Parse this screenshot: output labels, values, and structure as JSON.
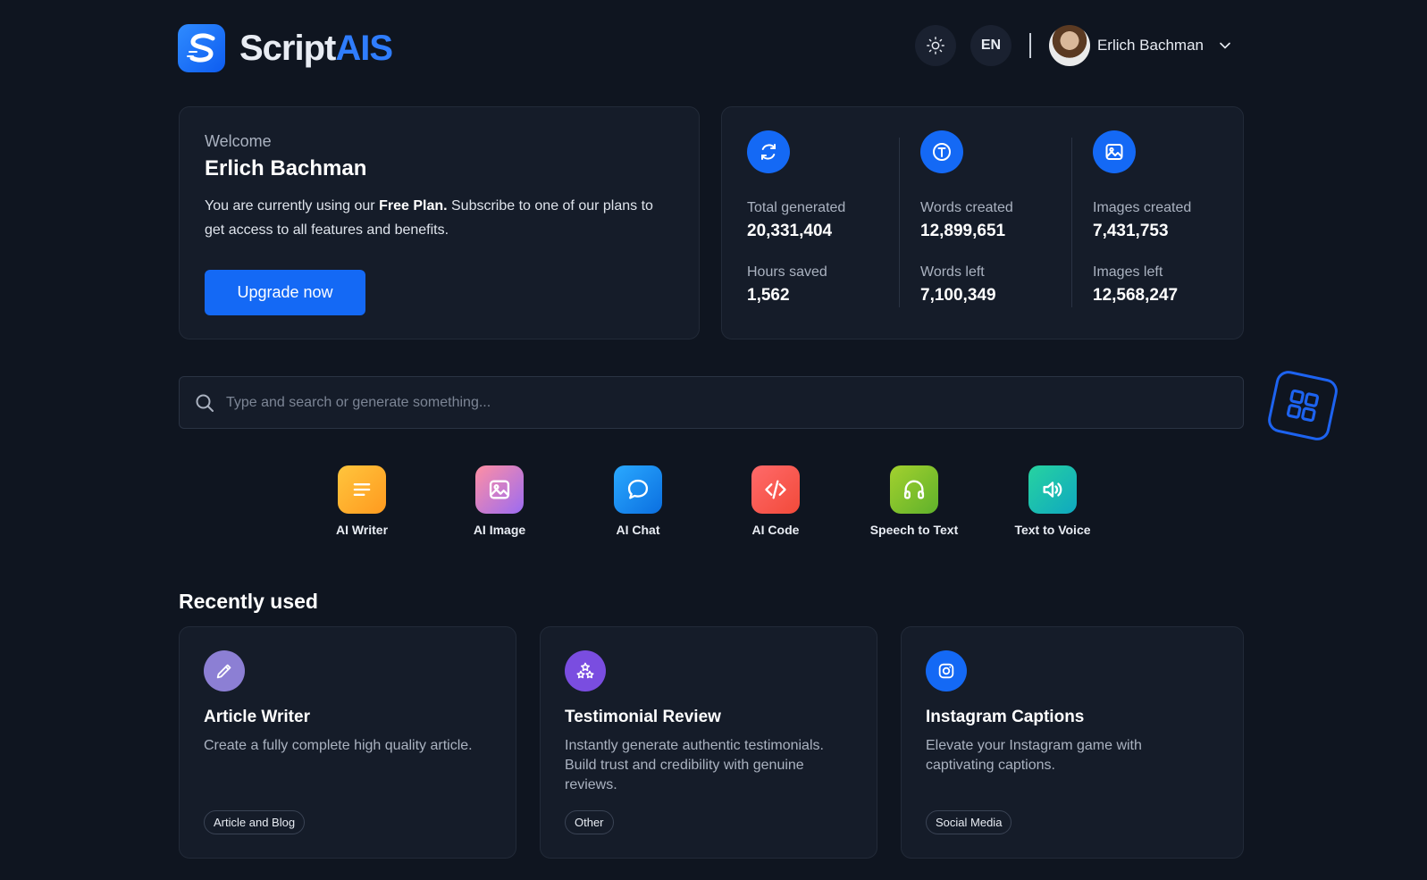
{
  "brand": {
    "name_main": "Script",
    "name_accent": "AIS",
    "accent": "#2f7dff"
  },
  "header": {
    "theme_icon": "sun-icon",
    "language": "EN",
    "user_name": "Erlich Bachman"
  },
  "welcome": {
    "greeting": "Welcome",
    "name": "Erlich Bachman",
    "desc_prefix": "You are currently using our ",
    "plan": "Free Plan.",
    "desc_suffix": " Subscribe to one of our plans to get access to all features and benefits.",
    "cta": "Upgrade now"
  },
  "stats": [
    {
      "icon": "refresh-icon",
      "label1": "Total generated",
      "value1": "20,331,404",
      "label2": "Hours saved",
      "value2": "1,562"
    },
    {
      "icon": "text-icon",
      "label1": "Words created",
      "value1": "12,899,651",
      "label2": "Words left",
      "value2": "7,100,349"
    },
    {
      "icon": "image-icon",
      "label1": "Images created",
      "value1": "7,431,753",
      "label2": "Images left",
      "value2": "12,568,247"
    }
  ],
  "search": {
    "placeholder": "Type and search or generate something..."
  },
  "tools": [
    {
      "label": "AI Writer",
      "icon": "lines-icon"
    },
    {
      "label": "AI Image",
      "icon": "image-icon"
    },
    {
      "label": "AI Chat",
      "icon": "chat-bubble-icon"
    },
    {
      "label": "AI Code",
      "icon": "code-icon"
    },
    {
      "label": "Speech to Text",
      "icon": "headphones-icon"
    },
    {
      "label": "Text to Voice",
      "icon": "speaker-icon"
    }
  ],
  "recent": {
    "title": "Recently used",
    "items": [
      {
        "title": "Article Writer",
        "desc": "Create a fully complete high quality article.",
        "tag": "Article and Blog",
        "icon": "pencil-icon"
      },
      {
        "title": "Testimonial Review",
        "desc": "Instantly generate authentic testimonials. Build trust and credibility with genuine reviews.",
        "tag": "Other",
        "icon": "stars-icon"
      },
      {
        "title": "Instagram Captions",
        "desc": "Elevate your Instagram game with captivating captions.",
        "tag": "Social Media",
        "icon": "instagram-icon"
      }
    ]
  }
}
